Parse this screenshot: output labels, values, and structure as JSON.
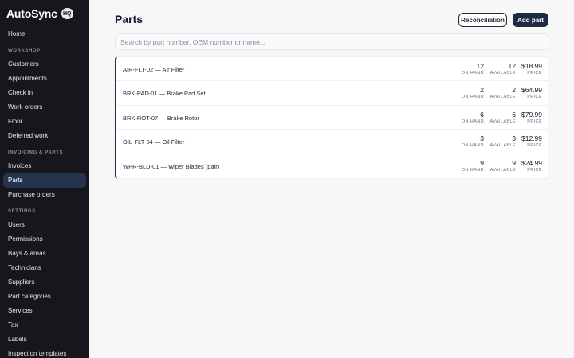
{
  "app": {
    "name": "AutoSync",
    "badge": "HQ"
  },
  "sidebar": {
    "top_items": [
      {
        "label": "Home"
      }
    ],
    "sections": [
      {
        "label": "WORKSHOP",
        "items": [
          {
            "label": "Customers"
          },
          {
            "label": "Appointments"
          },
          {
            "label": "Check in"
          },
          {
            "label": "Work orders"
          },
          {
            "label": "Floor"
          },
          {
            "label": "Deferred work"
          }
        ]
      },
      {
        "label": "INVOICING & PARTS",
        "items": [
          {
            "label": "Invoices"
          },
          {
            "label": "Parts",
            "active": true
          },
          {
            "label": "Purchase orders"
          }
        ]
      },
      {
        "label": "SETTINGS",
        "items": [
          {
            "label": "Users"
          },
          {
            "label": "Permissions"
          },
          {
            "label": "Bays & areas"
          },
          {
            "label": "Technicians"
          },
          {
            "label": "Suppliers"
          },
          {
            "label": "Part categories"
          },
          {
            "label": "Services"
          },
          {
            "label": "Tax"
          },
          {
            "label": "Labels"
          },
          {
            "label": "Inspection templates"
          }
        ]
      }
    ]
  },
  "header": {
    "title": "Parts",
    "reconciliation_label": "Reconciliation",
    "add_part_label": "Add part"
  },
  "search": {
    "placeholder": "Search by part number, OEM number or name...",
    "value": ""
  },
  "list_labels": {
    "on_hand": "ON HAND",
    "available": "AVAILABLE",
    "price": "PRICE"
  },
  "parts": [
    {
      "name": "AIR-FLT-02 — Air Filter",
      "on_hand": "12",
      "available": "12",
      "price": "$18.99"
    },
    {
      "name": "BRK-PAD-01 — Brake Pad Set",
      "on_hand": "2",
      "available": "2",
      "price": "$64.99"
    },
    {
      "name": "BRK-ROT-07 — Brake Rotor",
      "on_hand": "6",
      "available": "6",
      "price": "$79.99"
    },
    {
      "name": "OIL-FLT-04 — Oil Filter",
      "on_hand": "3",
      "available": "3",
      "price": "$12.99"
    },
    {
      "name": "WPR-BLD-01 — Wiper Blades (pair)",
      "on_hand": "9",
      "available": "9",
      "price": "$24.99"
    }
  ],
  "colors": {
    "sidebar_bg": "#15171c",
    "active_item_bg": "#25344d",
    "primary": "#1e2b44",
    "page_bg": "#f7f7f8"
  }
}
